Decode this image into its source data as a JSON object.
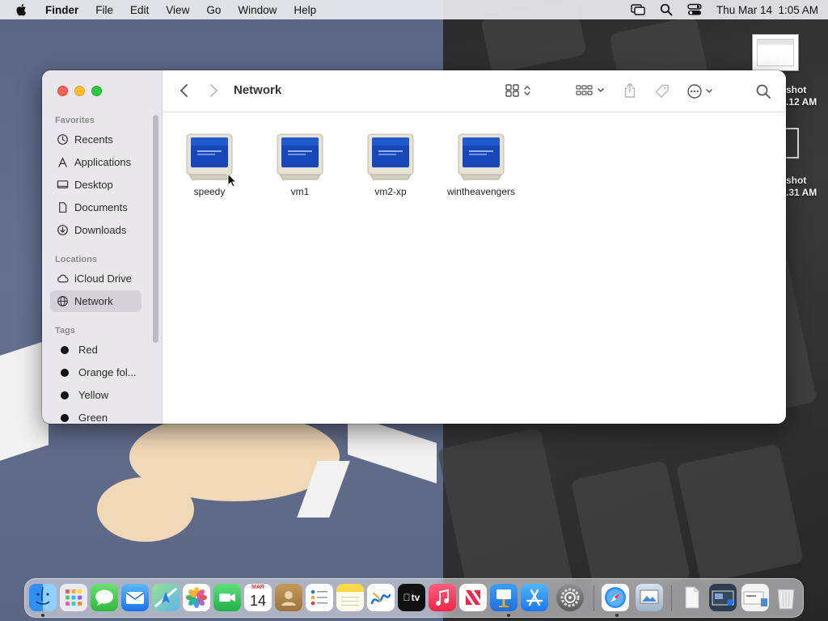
{
  "menubar": {
    "app": "Finder",
    "items": [
      "File",
      "Edit",
      "View",
      "Go",
      "Window",
      "Help"
    ],
    "clock": "Thu Mar 14  1:05 AM"
  },
  "desktop": {
    "files": [
      {
        "label_line1": "shot",
        "label_line2": ".12 AM"
      },
      {
        "label_line1": "shot",
        "label_line2": ".31 AM"
      }
    ]
  },
  "window": {
    "title": "Network",
    "sidebar": {
      "favorites_header": "Favorites",
      "favorites": [
        {
          "label": "Recents",
          "icon": "clock-icon"
        },
        {
          "label": "Applications",
          "icon": "applications-icon"
        },
        {
          "label": "Desktop",
          "icon": "desktop-icon"
        },
        {
          "label": "Documents",
          "icon": "document-icon"
        },
        {
          "label": "Downloads",
          "icon": "download-icon"
        }
      ],
      "locations_header": "Locations",
      "locations": [
        {
          "label": "iCloud Drive",
          "icon": "cloud-icon"
        },
        {
          "label": "Network",
          "icon": "globe-icon",
          "selected": true
        }
      ],
      "tags_header": "Tags",
      "tags": [
        {
          "label": "Red"
        },
        {
          "label": "Orange fol..."
        },
        {
          "label": "Yellow"
        },
        {
          "label": "Green"
        }
      ]
    },
    "items": [
      {
        "label": "speedy"
      },
      {
        "label": "vm1"
      },
      {
        "label": "vm2-xp"
      },
      {
        "label": "wintheavengers"
      }
    ]
  },
  "dock": {
    "calendar_month": "MAR",
    "calendar_day": "14",
    "tv_label": "tv"
  }
}
